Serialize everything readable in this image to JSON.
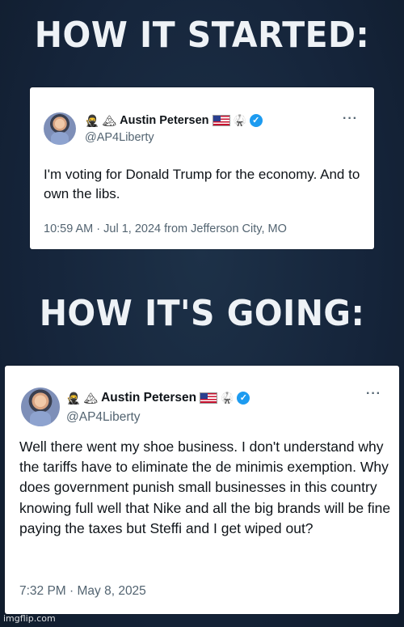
{
  "headings": {
    "top": "HOW IT STARTED:",
    "middle": "HOW IT'S GOING:"
  },
  "tweet1": {
    "emoji_prefix": "🥷 🏔",
    "name": "Austin Petersen",
    "handle": "@AP4Liberty",
    "text": "I'm voting for Donald Trump for the economy. And to own the libs.",
    "meta": "10:59 AM · Jul 1, 2024 from Jefferson City, MO",
    "more": "···"
  },
  "tweet2": {
    "emoji_prefix": "🥷 🏔",
    "name": "Austin Petersen",
    "handle": "@AP4Liberty",
    "text": "Well there went my shoe business. I don't understand why the tariffs have to eliminate the de minimis exemption. Why does government punish small businesses in this country knowing full well that Nike and all the big brands will be fine paying the taxes but Steffi and I get wiped out?",
    "meta": "7:32 PM · May 8, 2025",
    "more": "···"
  },
  "watermark": "imgflip.com",
  "colors": {
    "background": "#17273a",
    "heading": "#eef2f6",
    "verified": "#1d9bf0",
    "muted": "#536471"
  }
}
